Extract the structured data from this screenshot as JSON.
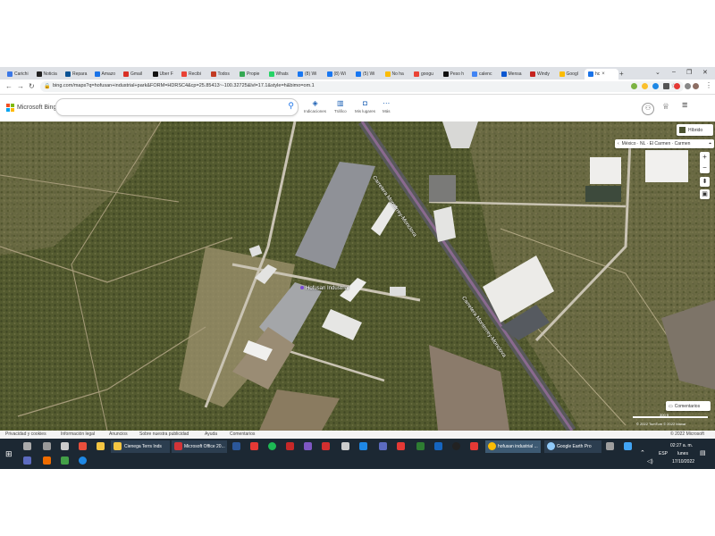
{
  "browser": {
    "tabs": [
      {
        "label": "Carichi",
        "color": "#3b78e7"
      },
      {
        "label": "Noticia",
        "color": "#222222"
      },
      {
        "label": "Repara",
        "color": "#0b5394"
      },
      {
        "label": "Amazo",
        "color": "#1a73e8"
      },
      {
        "label": "Gmail",
        "color": "#d93025"
      },
      {
        "label": "Uber F",
        "color": "#111111"
      },
      {
        "label": "Recibi",
        "color": "#e94235"
      },
      {
        "label": "Todos",
        "color": "#c23b22"
      },
      {
        "label": "Propie",
        "color": "#34a853"
      },
      {
        "label": "Whats",
        "color": "#25d366"
      },
      {
        "label": "(8) Wi",
        "color": "#1877f2"
      },
      {
        "label": "(8) Wi",
        "color": "#1877f2"
      },
      {
        "label": "(5) Wi",
        "color": "#1877f2"
      },
      {
        "label": "No ha",
        "color": "#fbbc04"
      },
      {
        "label": "googu",
        "color": "#ea4335"
      },
      {
        "label": "Peso h",
        "color": "#111111"
      },
      {
        "label": "calenc",
        "color": "#4285f4"
      },
      {
        "label": "Mensa",
        "color": "#0b57d0"
      },
      {
        "label": "Windy",
        "color": "#c5221f"
      },
      {
        "label": "Googl",
        "color": "#fbbc04"
      },
      {
        "label": "hc",
        "color": "#1a73e8",
        "active": true
      }
    ],
    "close_tab": "×",
    "new_tab": "+",
    "url": "bing.com/maps?q=hofusan+industrial+park&FORM=HDRSC4&cp=25.85413~-100.32725&lvl=17.1&style=h&bimo=om.1"
  },
  "bing": {
    "logo_text": "Microsoft Bing",
    "search_placeholder": "",
    "nav": [
      {
        "label": "Indicaciones",
        "icon": "directions-icon"
      },
      {
        "label": "Tráfico",
        "icon": "traffic-icon"
      },
      {
        "label": "Mis lugares",
        "icon": "places-icon"
      },
      {
        "label": "Más",
        "icon": "more-icon"
      }
    ]
  },
  "map": {
    "style_button": "Híbrido",
    "breadcrumb": "México · NL · El Carmen · Carmen",
    "labels": {
      "road1": "Carretera Monterrey-Monclova",
      "road2": "Carretera Monterrey-Monclova",
      "park": "Hofusan Industrial"
    },
    "scale": "300 ft",
    "copyright": "© 2022 TomTom © 2022 Maxar",
    "feedback": "Comentarios",
    "bottom_right": "© 2022 Microsoft"
  },
  "footer": {
    "links": [
      "Privacidad y cookies",
      "Información legal",
      "Anuncios",
      "Sobre nuestra publicidad",
      "Ayuda",
      "Comentarios"
    ]
  },
  "taskbar": {
    "windows": [
      {
        "label": "Cienega Terrs Inds"
      },
      {
        "label": "Microsoft Office 20..."
      },
      {
        "label": "hofusan industrial ..."
      },
      {
        "label": "Google Earth Pro"
      }
    ],
    "time": "02:27 a. m.",
    "day": "lunes",
    "date": "17/10/2022",
    "lang": "ESP"
  }
}
